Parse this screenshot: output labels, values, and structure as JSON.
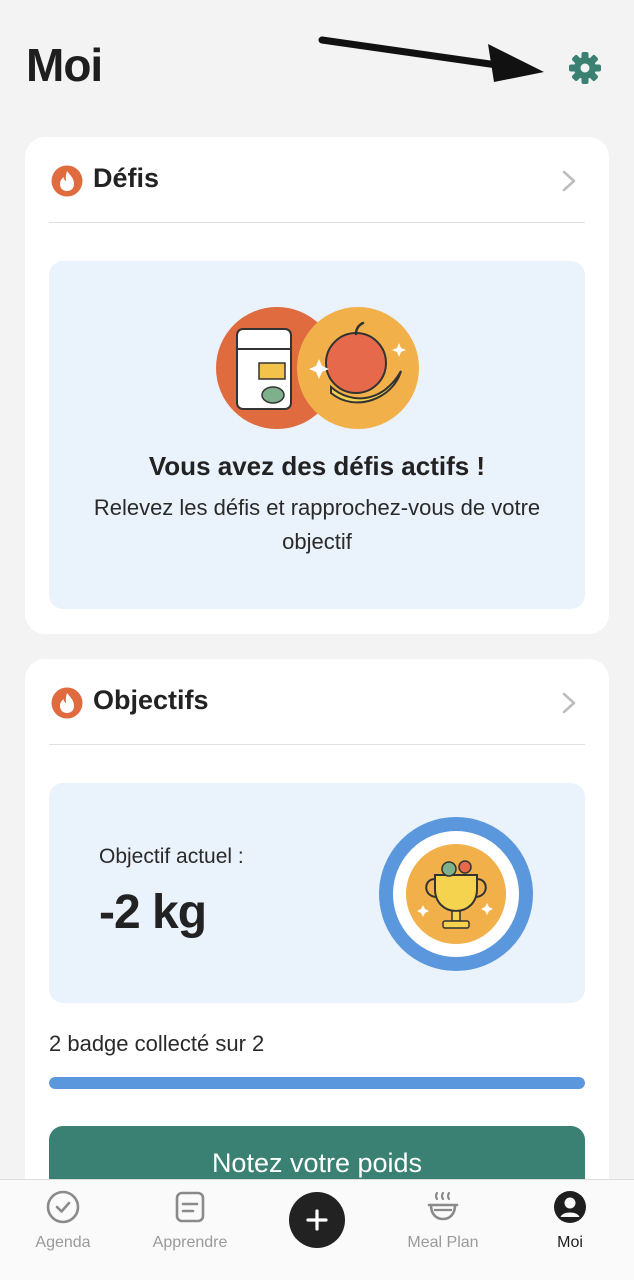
{
  "header": {
    "title": "Moi"
  },
  "colors": {
    "accent": "#3a8174",
    "flame": "#e06b3f",
    "progress": "#5b97dc",
    "panel": "#eaf2fb"
  },
  "challenges": {
    "title": "Défis",
    "heading": "Vous avez des défis actifs !",
    "text": "Relevez les défis et rapprochez-vous de votre objectif"
  },
  "goals": {
    "title": "Objectifs",
    "current_label": "Objectif actuel :",
    "current_value": "-2 kg",
    "badges_text": "2 badge collecté sur 2",
    "badges_progress": 1.0,
    "cta": "Notez votre poids"
  },
  "tabbar": {
    "items": [
      {
        "label": "Agenda",
        "icon": "check-circle-icon",
        "active": false
      },
      {
        "label": "Apprendre",
        "icon": "notepad-icon",
        "active": false
      },
      {
        "label": "",
        "icon": "plus-icon",
        "active": false
      },
      {
        "label": "Meal Plan",
        "icon": "bowl-icon",
        "active": false
      },
      {
        "label": "Moi",
        "icon": "profile-icon",
        "active": true
      }
    ]
  }
}
